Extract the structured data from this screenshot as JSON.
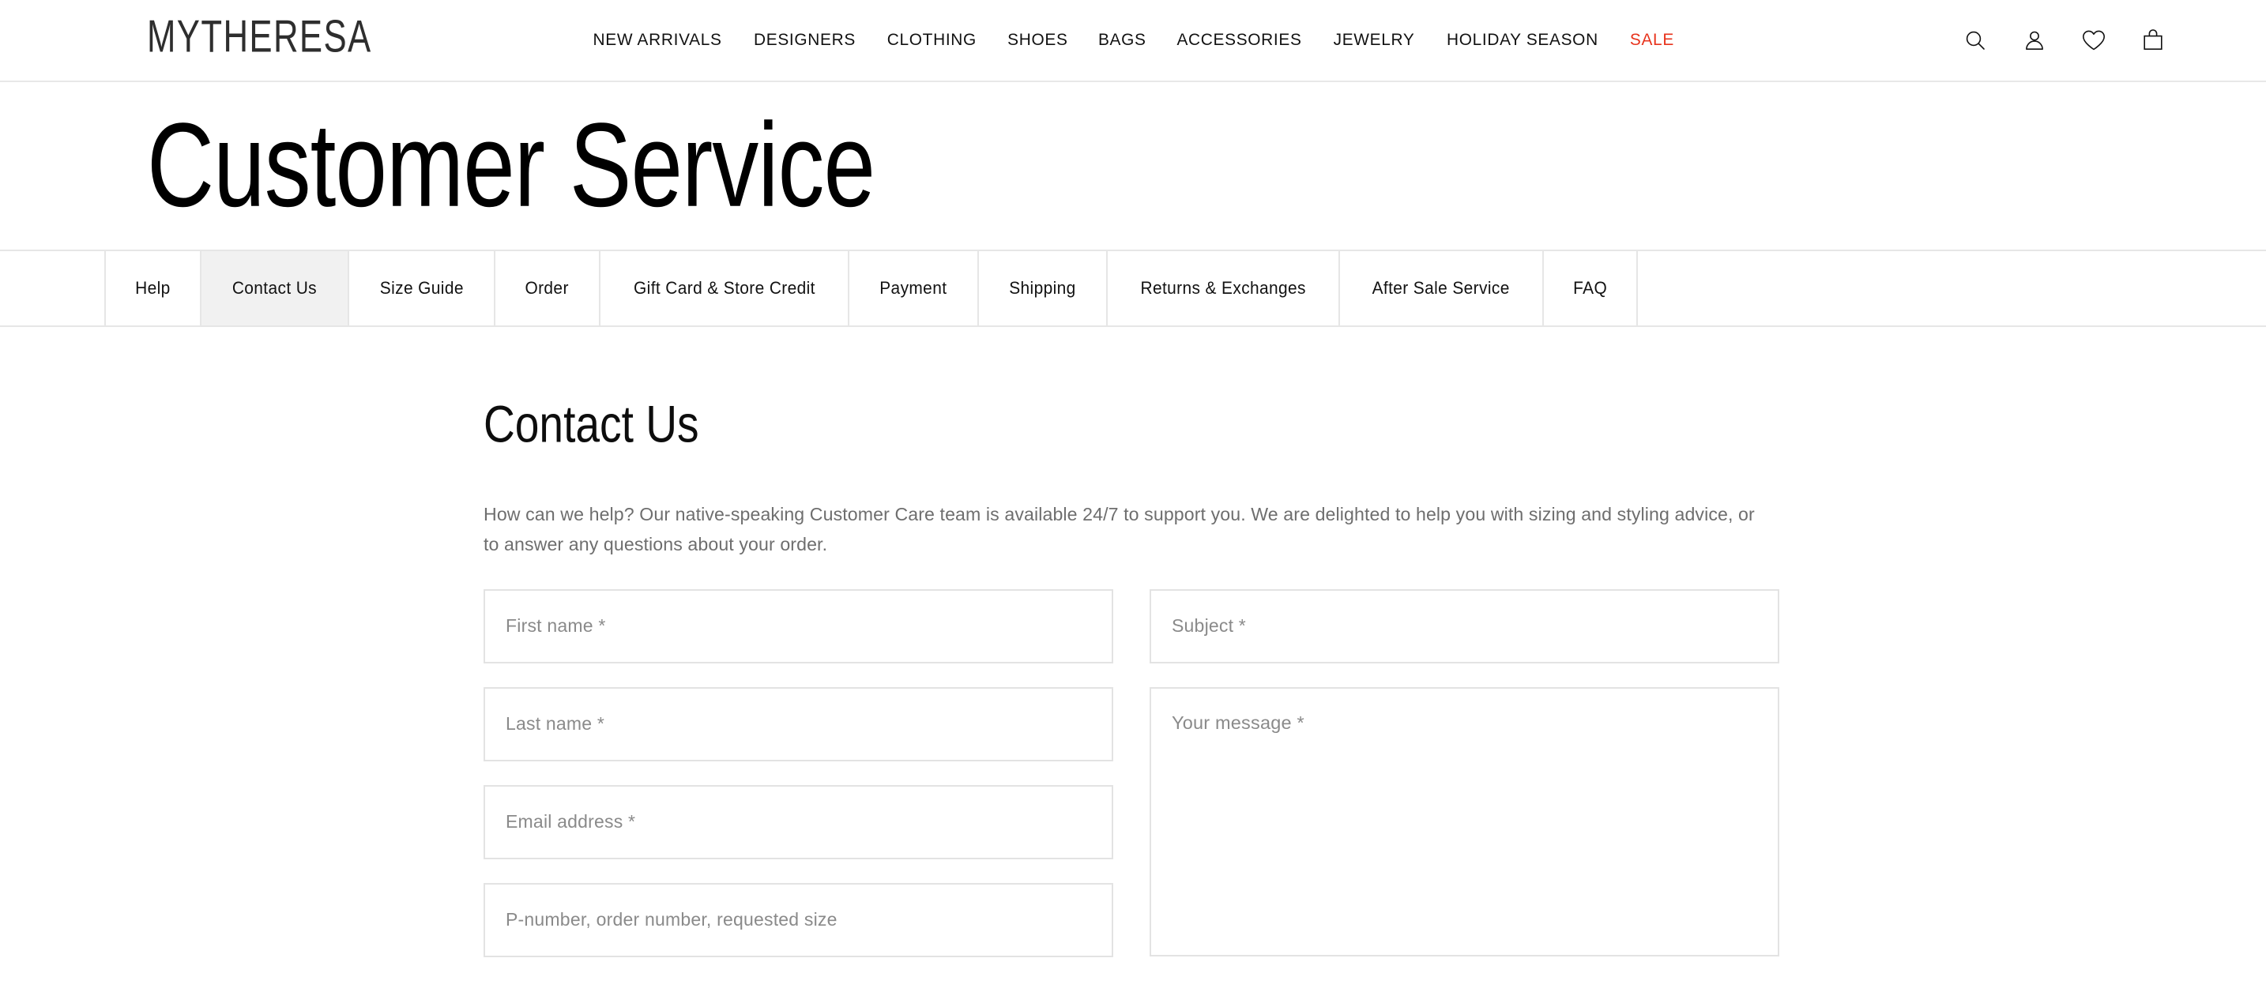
{
  "brand": {
    "logo_text": "MYTHERESA"
  },
  "header": {
    "nav": [
      {
        "label": "NEW ARRIVALS",
        "accent": false
      },
      {
        "label": "DESIGNERS",
        "accent": false
      },
      {
        "label": "CLOTHING",
        "accent": false
      },
      {
        "label": "SHOES",
        "accent": false
      },
      {
        "label": "BAGS",
        "accent": false
      },
      {
        "label": "ACCESSORIES",
        "accent": false
      },
      {
        "label": "JEWELRY",
        "accent": false
      },
      {
        "label": "HOLIDAY SEASON",
        "accent": false
      },
      {
        "label": "SALE",
        "accent": true
      }
    ],
    "icons": [
      {
        "name": "search-icon"
      },
      {
        "name": "account-icon"
      },
      {
        "name": "wishlist-heart-icon"
      },
      {
        "name": "shopping-bag-icon"
      }
    ],
    "sale_color": "#e8331c"
  },
  "page": {
    "title": "Customer Service"
  },
  "tabs": [
    {
      "label": "Help",
      "active": false
    },
    {
      "label": "Contact Us",
      "active": true
    },
    {
      "label": "Size Guide",
      "active": false
    },
    {
      "label": "Order",
      "active": false
    },
    {
      "label": "Gift Card & Store Credit",
      "active": false
    },
    {
      "label": "Payment",
      "active": false
    },
    {
      "label": "Shipping",
      "active": false
    },
    {
      "label": "Returns & Exchanges",
      "active": false
    },
    {
      "label": "After Sale Service",
      "active": false
    },
    {
      "label": "FAQ",
      "active": false
    }
  ],
  "main": {
    "heading": "Contact Us",
    "intro": "How can we help? Our native-speaking Customer Care team is available 24/7 to support you. We are delighted to help you with sizing and styling advice, or to answer any questions about your order.",
    "form": {
      "left_fields": [
        {
          "name": "first-name-field",
          "placeholder": "First name *",
          "value": ""
        },
        {
          "name": "last-name-field",
          "placeholder": "Last name *",
          "value": ""
        },
        {
          "name": "email-address-field",
          "placeholder": "Email address *",
          "value": ""
        },
        {
          "name": "order-reference-field",
          "placeholder": "P-number, order number, requested size",
          "value": ""
        }
      ],
      "subject_field": {
        "name": "subject-field",
        "placeholder": "Subject *",
        "value": ""
      },
      "message_field": {
        "name": "message-textarea",
        "placeholder": "Your message *",
        "value": ""
      }
    }
  },
  "colors": {
    "accent_sale": "#e8331c",
    "border": "#e3e3e3",
    "tab_active_bg": "#f1f1f1",
    "muted_text": "#6e6e6e",
    "placeholder_text": "#8a8a8a"
  }
}
